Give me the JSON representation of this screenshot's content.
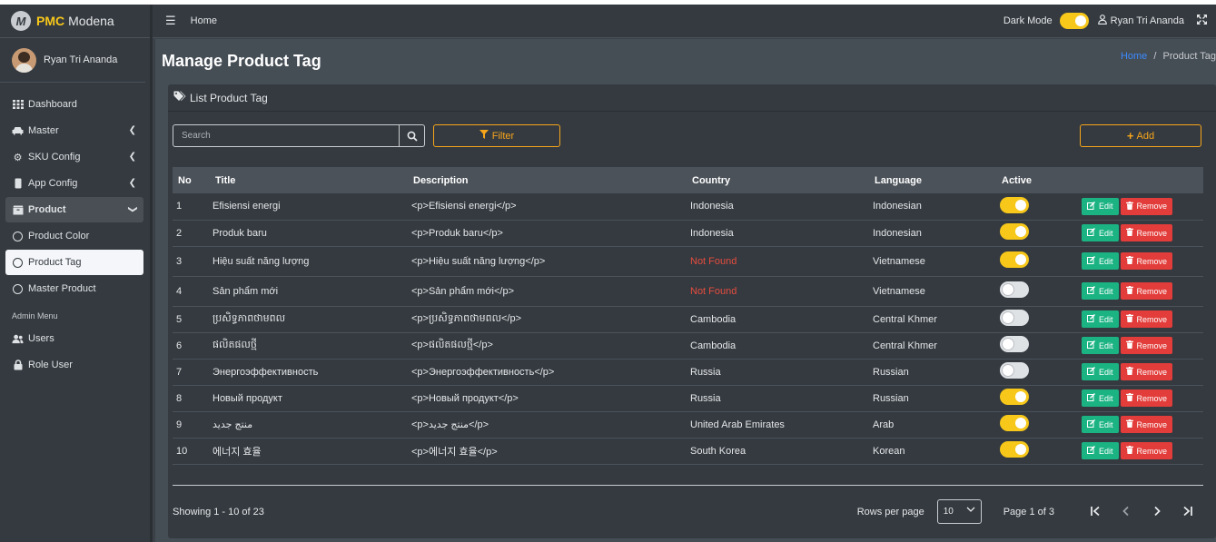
{
  "brand": {
    "logo_letter": "M",
    "pmc": "PMC",
    "name": "Modena"
  },
  "sidebar": {
    "user_name": "Ryan Tri Ananda",
    "items": [
      {
        "label": "Dashboard",
        "icon": "grid-icon"
      },
      {
        "label": "Master",
        "icon": "car-icon"
      },
      {
        "label": "SKU Config",
        "icon": "gear-icon"
      },
      {
        "label": "App Config",
        "icon": "phone-icon"
      },
      {
        "label": "Product",
        "icon": "box-icon"
      },
      {
        "label": "Product Color",
        "icon": "circle-icon"
      },
      {
        "label": "Product Tag",
        "icon": "circle-icon"
      },
      {
        "label": "Master Product",
        "icon": "circle-icon"
      }
    ],
    "admin_header": "Admin Menu",
    "admin_items": [
      {
        "label": "Users",
        "icon": "users-icon"
      },
      {
        "label": "Role User",
        "icon": "lock-icon"
      }
    ]
  },
  "topbar": {
    "home": "Home",
    "dark_mode_label": "Dark Mode",
    "user_name": "Ryan Tri Ananda"
  },
  "page": {
    "title": "Manage Product Tag",
    "breadcrumb_home": "Home",
    "breadcrumb_sep": "/",
    "breadcrumb_current": "Product Tag"
  },
  "card": {
    "title": "List Product Tag",
    "search_placeholder": "Search",
    "filter_label": "Filter",
    "add_label": "Add"
  },
  "table": {
    "headers": [
      "No",
      "Title",
      "Description",
      "Country",
      "Language",
      "Active"
    ],
    "edit_label": "Edit",
    "remove_label": "Remove",
    "rows": [
      {
        "no": "1",
        "title": "Efisiensi energi",
        "description": "<p>Efisiensi energi</p>",
        "country": "Indonesia",
        "language": "Indonesian",
        "active": true
      },
      {
        "no": "2",
        "title": "Produk baru",
        "description": "<p>Produk baru</p>",
        "country": "Indonesia",
        "language": "Indonesian",
        "active": true
      },
      {
        "no": "3",
        "title": "Hiệu suất năng lượng",
        "description": "<p>Hiệu suất năng lượng</p>",
        "country": "Not Found",
        "language": "Vietnamese",
        "active": true
      },
      {
        "no": "4",
        "title": "Sản phẩm mới",
        "description": "<p>Sản phẩm mới</p>",
        "country": "Not Found",
        "language": "Vietnamese",
        "active": false
      },
      {
        "no": "5",
        "title": "ប្រសិទ្ធភាពថាមពល",
        "description": "<p>ប្រសិទ្ធភាពថាមពល</p>",
        "country": "Cambodia",
        "language": "Central Khmer",
        "active": false
      },
      {
        "no": "6",
        "title": "ផលិតផលថ្មី",
        "description": "<p>ផលិតផលថ្មី</p>",
        "country": "Cambodia",
        "language": "Central Khmer",
        "active": false
      },
      {
        "no": "7",
        "title": "Энергоэффективность",
        "description": "<p>Энергоэффективность</p>",
        "country": "Russia",
        "language": "Russian",
        "active": false
      },
      {
        "no": "8",
        "title": "Новый продукт",
        "description": "<p>Новый продукт</p>",
        "country": "Russia",
        "language": "Russian",
        "active": true
      },
      {
        "no": "9",
        "title": "منتج جديد",
        "description": "<p>منتج جديد</p>",
        "country": "United Arab Emirates",
        "language": "Arab",
        "active": true
      },
      {
        "no": "10",
        "title": "에너지 효율",
        "description": "<p>에너지 효율</p>",
        "country": "South Korea",
        "language": "Korean",
        "active": true
      }
    ]
  },
  "footer": {
    "showing": "Showing 1 - 10 of 23",
    "rows_per_page_label": "Rows per page",
    "rows_per_page_value": "10",
    "page_of": "Page 1 of 3"
  },
  "colors": {
    "accent": "#f7c71a",
    "edit": "#1cb383",
    "remove": "#e23d3a",
    "not_found": "#e84c3d"
  }
}
